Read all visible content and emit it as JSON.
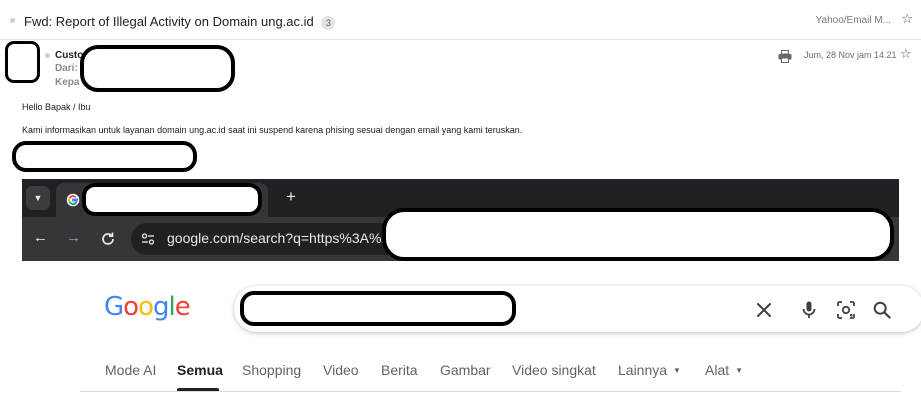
{
  "email": {
    "subject": "Fwd: Report of Illegal Activity on Domain ung.ac.id",
    "thread_count": "3",
    "folder": "Yahoo/Email M...",
    "sender_name": "Custo",
    "from_label": "Dari:",
    "to_label": "Kepa",
    "date": "Jum, 28 Nov jam 14.21",
    "greeting": "Hello Bapak / Ibu",
    "body": "Kami informasikan untuk layanan domain ung.ac.id saat ini suspend karena phising sesuai dengan email yang kami teruskan."
  },
  "browser": {
    "url": "google.com/search?q=https%3A%2F"
  },
  "google": {
    "logo_letters": [
      {
        "ch": "G",
        "color": "#4285F4"
      },
      {
        "ch": "o",
        "color": "#EA4335"
      },
      {
        "ch": "o",
        "color": "#FBBC05"
      },
      {
        "ch": "g",
        "color": "#4285F4"
      },
      {
        "ch": "l",
        "color": "#34A853"
      },
      {
        "ch": "e",
        "color": "#EA4335"
      }
    ],
    "tabs": [
      {
        "label": "Mode AI",
        "active": false
      },
      {
        "label": "Semua",
        "active": true
      },
      {
        "label": "Shopping",
        "active": false
      },
      {
        "label": "Video",
        "active": false
      },
      {
        "label": "Berita",
        "active": false
      },
      {
        "label": "Gambar",
        "active": false
      },
      {
        "label": "Video singkat",
        "active": false
      },
      {
        "label": "Lainnya",
        "active": false,
        "dropdown": true
      },
      {
        "label": "Alat",
        "active": false,
        "dropdown": true
      }
    ]
  },
  "icons": {
    "star": "star-outline-icon",
    "print": "printer-icon",
    "tab_menu": "chevron-down-icon",
    "new_tab": "plus-icon",
    "back": "arrow-left-icon",
    "forward": "arrow-right-icon",
    "reload": "reload-icon",
    "site_info": "tune-icon",
    "clear": "close-icon",
    "mic": "microphone-icon",
    "lens": "camera-lens-icon",
    "search": "search-icon"
  }
}
